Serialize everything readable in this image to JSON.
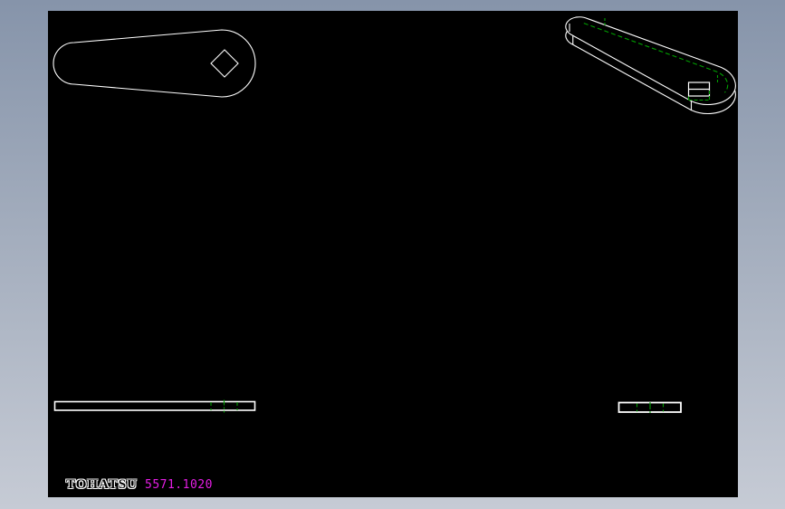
{
  "window": {
    "bg_gradient_top": "#8694aa",
    "bg_gradient_bottom": "#c6cbd5"
  },
  "canvas": {
    "background": "#000000"
  },
  "palette": {
    "visible_edge": "#ffffff",
    "hidden_edge": "#00a000",
    "part_number_color": "#e61ee6",
    "logo_color": "#ffffff"
  },
  "title_block": {
    "brand": "TOHATSU",
    "part_number": "5571.1020"
  }
}
